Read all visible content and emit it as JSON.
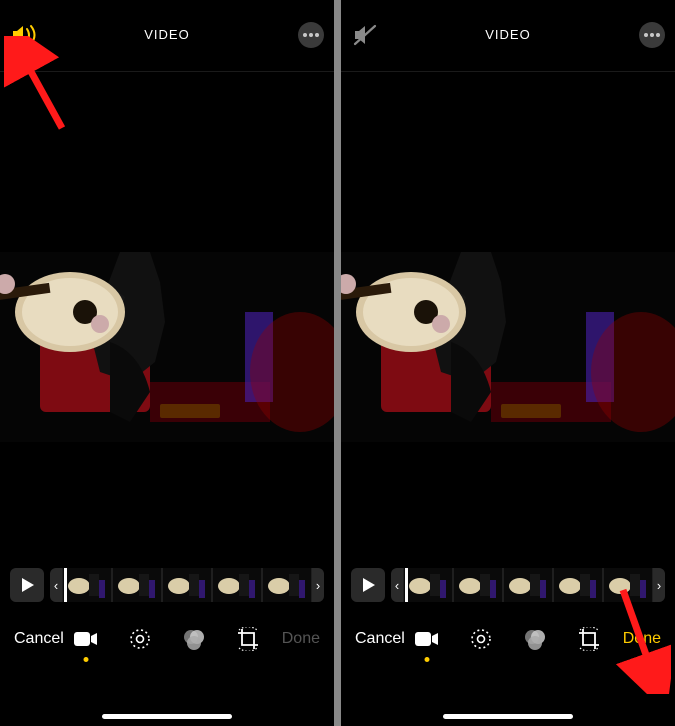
{
  "left": {
    "header": {
      "title": "VIDEO",
      "sound_on": true
    },
    "timeline": {
      "thumb_count": 5
    },
    "bottom": {
      "cancel": "Cancel",
      "done": "Done",
      "done_enabled": false,
      "active_tool_index": 0
    }
  },
  "right": {
    "header": {
      "title": "VIDEO",
      "sound_on": false
    },
    "timeline": {
      "thumb_count": 5
    },
    "bottom": {
      "cancel": "Cancel",
      "done": "Done",
      "done_enabled": true,
      "active_tool_index": 0
    }
  },
  "colors": {
    "accent": "#ffcc00",
    "arrow": "#ff1a1a"
  }
}
